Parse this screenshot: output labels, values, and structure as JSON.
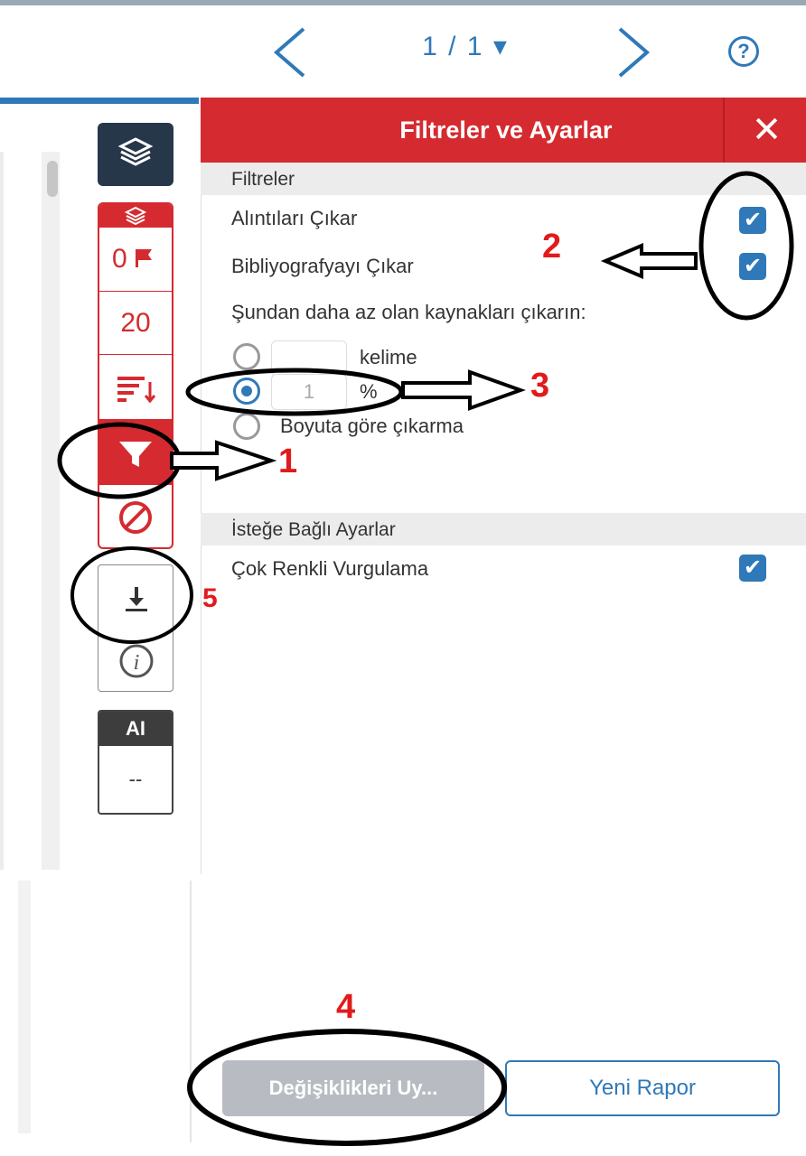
{
  "topbar": {
    "page_indicator": "1 / 1 ▾",
    "help_label": "?"
  },
  "sidebar": {
    "flag_count": "0",
    "match_count": "20",
    "ai_label": "AI",
    "ai_value": "--"
  },
  "panel": {
    "title": "Filtreler ve Ayarlar",
    "close_label": "✕",
    "filters_section": "Filtreler",
    "exclude_quotes": "Alıntıları Çıkar",
    "exclude_bibliography": "Bibliyografyayı Çıkar",
    "exclude_sources_label": "Şundan daha az olan kaynakları çıkarın:",
    "radio_words_label": "kelime",
    "radio_words_value": "",
    "radio_percent_label": "%",
    "radio_percent_value": "1",
    "radio_none_label": "Boyuta göre çıkarma",
    "optional_section": "İsteğe Bağlı Ayarlar",
    "multicolor_label": "Çok Renkli Vurgulama",
    "checked_states": {
      "exclude_quotes": true,
      "exclude_bibliography": true,
      "multicolor": true
    },
    "selected_radio": "percent"
  },
  "footer": {
    "apply_label": "Değişiklikleri Uy...",
    "new_report_label": "Yeni Rapor"
  },
  "annotations": {
    "marker_1": "1",
    "marker_2": "2",
    "marker_3": "3",
    "marker_4": "4",
    "marker_5": "5"
  },
  "colors": {
    "accent_red": "#d52a2f",
    "accent_blue": "#2f79b8",
    "dark_navy": "#27374a",
    "marker_red": "#e11b1b"
  }
}
